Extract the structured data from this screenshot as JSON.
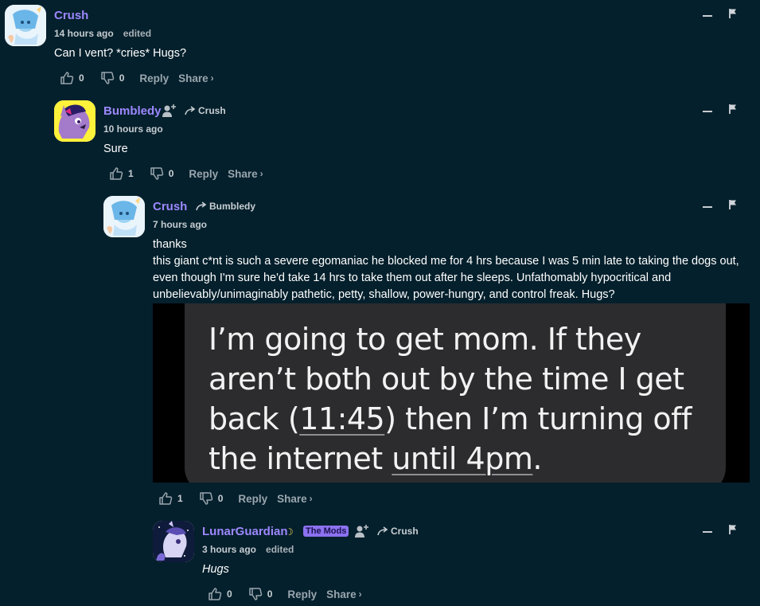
{
  "comments": [
    {
      "username": "Crush",
      "time": "14 hours ago",
      "edited": "edited",
      "body": "Can I vent? *cries* Hugs?",
      "upvotes": "0",
      "downvotes": "0",
      "reply": "Reply",
      "share": "Share",
      "avatar": "crush-avatar"
    },
    {
      "username": "Bumbledy",
      "reply_to": "Crush",
      "time": "10 hours ago",
      "body": "Sure",
      "upvotes": "1",
      "downvotes": "0",
      "reply": "Reply",
      "share": "Share",
      "avatar": "bumbledy-avatar"
    },
    {
      "username": "Crush",
      "reply_to": "Bumbledy",
      "time": "7 hours ago",
      "body_line1": "thanks",
      "body_line2": "this giant c*nt is such a severe egomaniac he blocked me for 4 hrs because I was 5 min late to taking the dogs out, even though I'm sure he'd take 14 hrs to take them out after he sleeps. Unfathomably hypocritical and unbelievably/unimaginably pathetic, petty, shallow, power-hungry, and control freak. Hugs?",
      "image_text": {
        "line1": "I’m going to get mom. If they",
        "line2": "aren’t both out by the time I get",
        "line3_a": "back (",
        "line3_time": "11:45",
        "line3_b": ") then I’m turning off",
        "line4_a": "the internet ",
        "line4_until": "until 4pm",
        "line4_b": "."
      },
      "upvotes": "1",
      "downvotes": "0",
      "reply": "Reply",
      "share": "Share",
      "avatar": "crush-avatar"
    },
    {
      "username": "LunarGuardian",
      "badge": "The Mods",
      "reply_to": "Crush",
      "time": "3 hours ago",
      "edited": "edited",
      "body": "Hugs",
      "upvotes": "0",
      "downvotes": "0",
      "reply": "Reply",
      "share": "Share",
      "avatar": "lunarguardian-avatar"
    }
  ],
  "colors": {
    "background": "#04202c",
    "username": "#9d88ff",
    "badge": "#8c72f0",
    "action_text": "#9aa6ae"
  },
  "icons": {
    "upvote": "thumbs-up-icon",
    "downvote": "thumbs-down-icon",
    "minimize": "minimize-icon",
    "flag": "flag-icon",
    "reply_arrow": "reply-arrow-icon",
    "follow": "follow-user-icon",
    "share_chevron": "chevron-right-icon",
    "moon": "moon-icon"
  }
}
